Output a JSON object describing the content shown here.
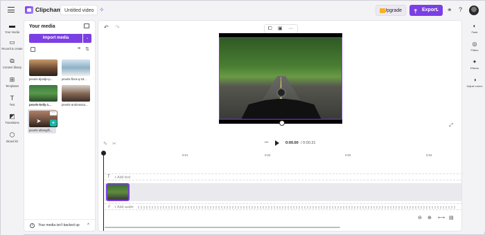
{
  "app": {
    "name": "Clipchamp",
    "video_title": "Untitled video"
  },
  "topbar": {
    "upgrade_label": "Upgrade",
    "export_label": "Export",
    "export_color": "#7b3fe4"
  },
  "left_rail": {
    "items": [
      {
        "label": "Your media",
        "icon": "folder-icon"
      },
      {
        "label": "Record & create",
        "icon": "camera-icon"
      },
      {
        "label": "Content library",
        "icon": "library-icon"
      },
      {
        "label": "Templates",
        "icon": "templates-icon"
      },
      {
        "label": "Text",
        "icon": "text-icon"
      },
      {
        "label": "Transitions",
        "icon": "transitions-icon"
      },
      {
        "label": "Brand kit",
        "icon": "brand-kit-icon"
      }
    ]
  },
  "media_panel": {
    "title": "Your media",
    "import_label": "Import media",
    "items": [
      {
        "label": "pexels-djordje-p..."
      },
      {
        "label": "pexels-flora-q-18..."
      },
      {
        "label": "pexels-kelly-1..."
      },
      {
        "label": "pexels-andreassa..."
      },
      {
        "label": "pexels-ultiangfil..."
      }
    ],
    "backup_notice": "Your media isn't backed up"
  },
  "playback": {
    "current_time": "0:00.00",
    "total_time": "/ 0:00.31"
  },
  "timeline": {
    "ticks": [
      "0:01",
      "0:02",
      "0:03",
      "0:04"
    ],
    "add_text_label": "+ Add text",
    "add_audio_label": "+ Add audio"
  },
  "right_rail": {
    "items": [
      {
        "label": "Fade",
        "icon": "fade-icon"
      },
      {
        "label": "Filters",
        "icon": "filters-icon"
      },
      {
        "label": "Effects",
        "icon": "effects-icon"
      },
      {
        "label": "Adjust colors",
        "icon": "adjust-colors-icon"
      }
    ]
  }
}
